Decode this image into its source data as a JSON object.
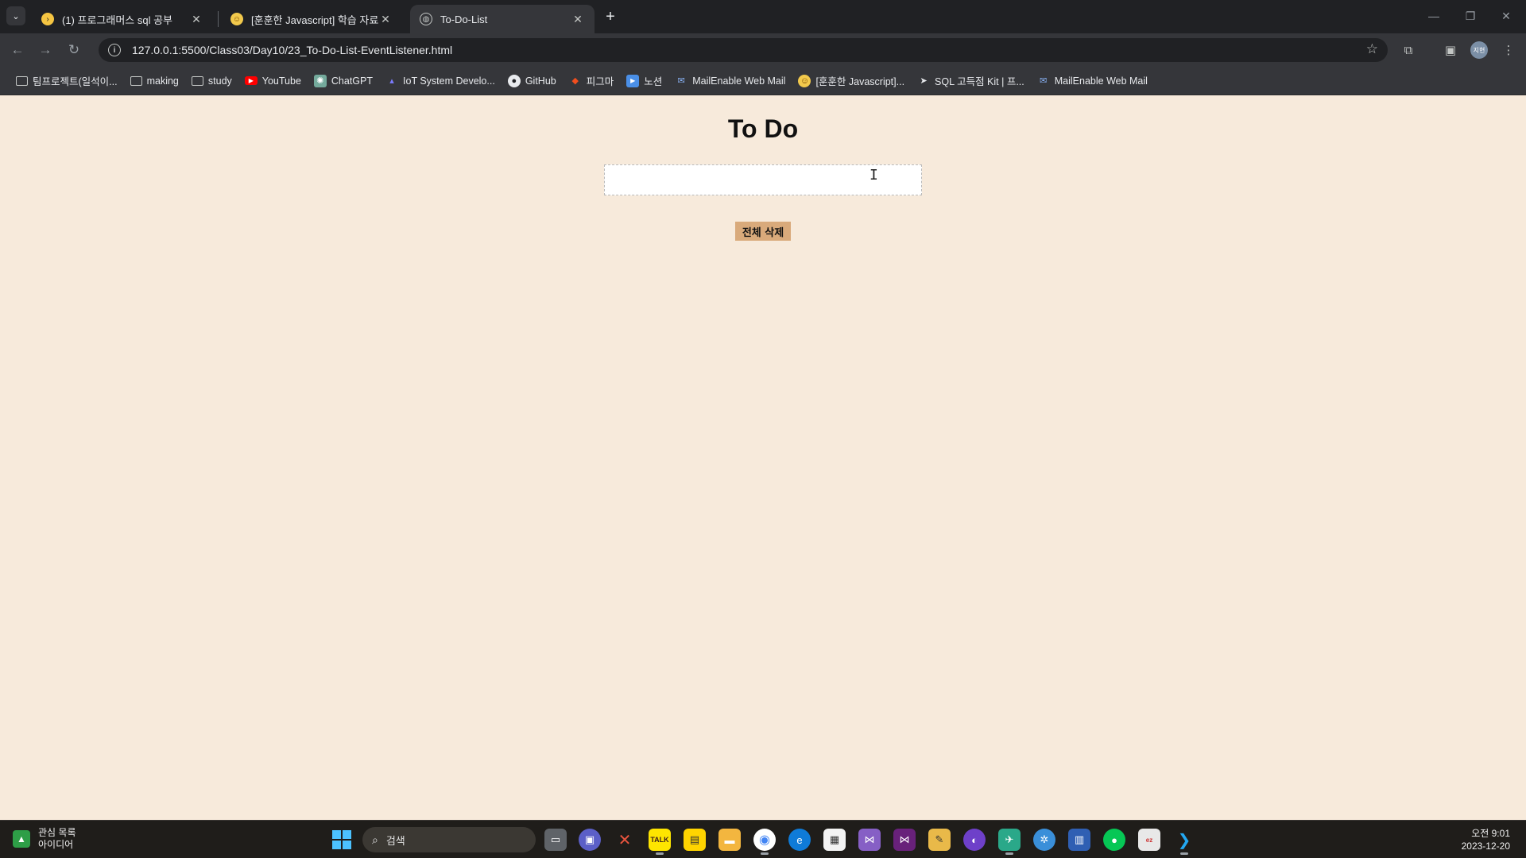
{
  "browser": {
    "tabs": [
      {
        "title": "(1) 프로그래머스 sql 공부",
        "favicon": "programmers-icon",
        "active": false
      },
      {
        "title": "[훈훈한 Javascript] 학습 자료",
        "favicon": "smile-icon",
        "active": false
      },
      {
        "title": "To-Do-List",
        "favicon": "globe-icon",
        "active": true
      }
    ],
    "url": "127.0.0.1:5500/Class03/Day10/23_To-Do-List-EventListener.html",
    "profile_initials": "지현",
    "bookmarks": [
      {
        "label": "팀프로젝트(일석이...",
        "icon": "folder-icon"
      },
      {
        "label": "making",
        "icon": "folder-icon"
      },
      {
        "label": "study",
        "icon": "folder-icon"
      },
      {
        "label": "YouTube",
        "icon": "youtube-icon"
      },
      {
        "label": "ChatGPT",
        "icon": "chatgpt-icon"
      },
      {
        "label": "IoT System Develo...",
        "icon": "iot-icon"
      },
      {
        "label": "GitHub",
        "icon": "github-icon"
      },
      {
        "label": "피그마",
        "icon": "figma-icon"
      },
      {
        "label": "노션",
        "icon": "notion-icon"
      },
      {
        "label": "MailEnable Web Mail",
        "icon": "mail-icon"
      },
      {
        "label": "[훈훈한 Javascript]...",
        "icon": "smile-icon"
      },
      {
        "label": "SQL 고득점 Kit | 프...",
        "icon": "programmers-icon"
      },
      {
        "label": "MailEnable Web Mail",
        "icon": "mail-icon"
      }
    ]
  },
  "page": {
    "title": "To Do",
    "input_value": "",
    "input_placeholder": "",
    "clear_button": "전체 삭제",
    "background_color": "#f7eadb",
    "button_color": "#d9aa7b"
  },
  "taskbar": {
    "widget_line1": "관심 목록",
    "widget_line2": "아이디어",
    "search_placeholder": "검색",
    "time": "오전 9:01",
    "date": "2023-12-20",
    "apps": [
      "task-view-icon",
      "teams-icon",
      "x-app-icon",
      "kakaotalk-icon",
      "sticky-notes-icon",
      "file-explorer-icon",
      "chrome-icon",
      "edge-icon",
      "store-icon",
      "visual-studio-icon",
      "visual-studio-2-icon",
      "photoshop-like-icon",
      "github-desktop-icon",
      "bird-app-icon",
      "network-icon",
      "remote-icon",
      "line-icon",
      "ezhelp-icon",
      "vscode-icon"
    ]
  }
}
